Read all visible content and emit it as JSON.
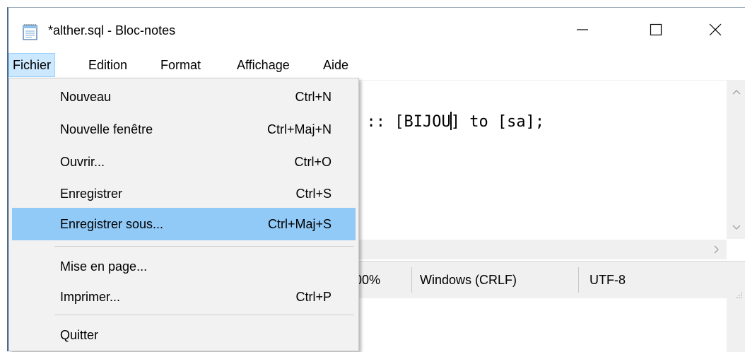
{
  "window": {
    "title": "*alther.sql - Bloc-notes",
    "app_icon": "notepad-icon",
    "controls": {
      "minimize": "minimize-icon",
      "maximize": "maximize-icon",
      "close": "close-icon"
    }
  },
  "menubar": {
    "items": [
      {
        "label": "Fichier",
        "active": true
      },
      {
        "label": "Edition"
      },
      {
        "label": "Format"
      },
      {
        "label": "Affichage"
      },
      {
        "label": "Aide"
      }
    ]
  },
  "editor": {
    "text_before_caret": "E :: [BIJOU",
    "text_after_caret": "] to [sa];"
  },
  "statusbar": {
    "zoom": "00%",
    "line_ending": "Windows (CRLF)",
    "encoding": "UTF-8"
  },
  "file_menu": {
    "items": [
      {
        "label": "Nouveau",
        "shortcut": "Ctrl+N"
      },
      {
        "label": "Nouvelle fenêtre",
        "shortcut": "Ctrl+Maj+N"
      },
      {
        "label": "Ouvrir...",
        "shortcut": "Ctrl+O"
      },
      {
        "label": "Enregistrer",
        "shortcut": "Ctrl+S"
      },
      {
        "label": "Enregistrer sous...",
        "shortcut": "Ctrl+Maj+S",
        "highlighted": true
      },
      {
        "label": "Mise en page...",
        "shortcut": ""
      },
      {
        "label": "Imprimer...",
        "shortcut": "Ctrl+P"
      },
      {
        "label": "Quitter",
        "shortcut": ""
      }
    ]
  },
  "colors": {
    "menu_highlight": "#91c9f7",
    "menubar_active": "#cce8ff",
    "chrome_gray": "#f0f0f0"
  }
}
